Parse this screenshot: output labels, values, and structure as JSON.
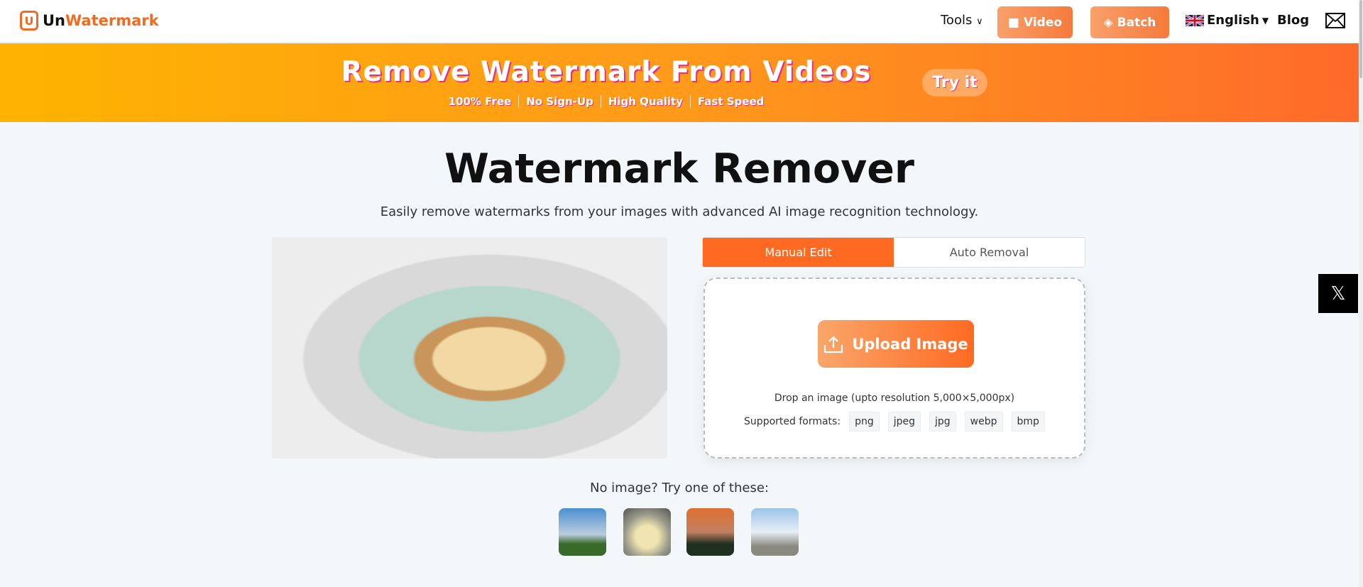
{
  "header": {
    "logo_prefix": "Un",
    "logo_suffix": "Watermark",
    "tools": "Tools",
    "video": "Video",
    "batch": "Batch",
    "language": "English",
    "blog": "Blog"
  },
  "banner": {
    "title": "Remove Watermark From Videos",
    "features": [
      "100% Free",
      "No Sign-Up",
      "High Quality",
      "Fast Speed"
    ],
    "cta": "Try it"
  },
  "main": {
    "title": "Watermark Remover",
    "subtitle": "Easily remove watermarks from your images with advanced AI image recognition technology.",
    "tabs": [
      {
        "label": "Manual Edit",
        "active": true
      },
      {
        "label": "Auto Removal",
        "active": false
      }
    ],
    "upload_label": "Upload Image",
    "drop_text": "Drop an image (upto resolution 5,000×5,000px)",
    "formats_label": "Supported formats:",
    "formats": [
      "png",
      "jpeg",
      "jpg",
      "webp",
      "bmp"
    ],
    "samples_label": "No image? Try one of these:"
  },
  "colors": {
    "accent": "#ff6a22",
    "banner_start": "#ffb300",
    "banner_end": "#ff6a2a"
  }
}
